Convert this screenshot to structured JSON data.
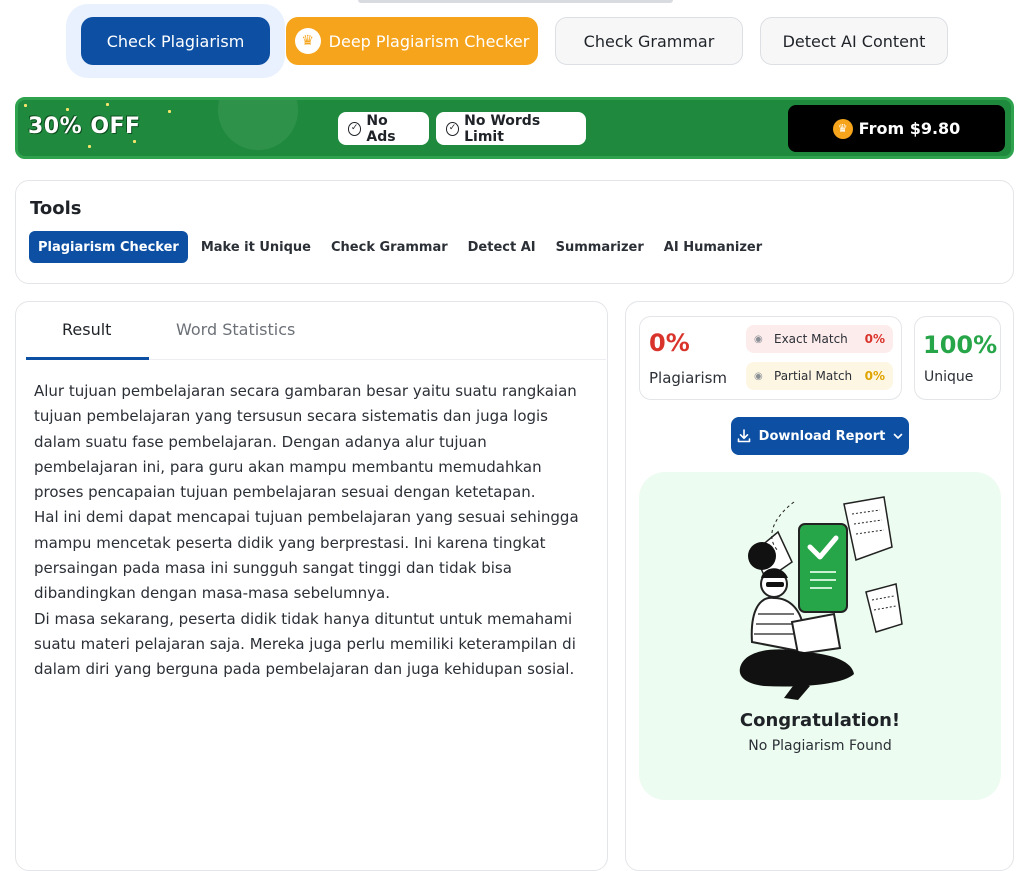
{
  "modes": {
    "check_plagiarism": "Check Plagiarism",
    "deep_checker": "Deep Plagiarism Checker",
    "check_grammar": "Check Grammar",
    "detect_ai": "Detect AI Content"
  },
  "promo": {
    "discount": "30% OFF",
    "no_ads": "No Ads",
    "no_words_limit": "No Words Limit",
    "price": "From $9.80"
  },
  "tools": {
    "title": "Tools",
    "items": [
      {
        "label": "Plagiarism Checker",
        "active": true
      },
      {
        "label": "Make it Unique"
      },
      {
        "label": "Check Grammar"
      },
      {
        "label": "Detect AI"
      },
      {
        "label": "Summarizer"
      },
      {
        "label": "AI Humanizer"
      }
    ]
  },
  "result": {
    "tabs": [
      "Result",
      "Word Statistics"
    ],
    "paragraphs": [
      "Alur tujuan pembelajaran secara gambaran besar yaitu suatu rangkaian tujuan pembelajaran yang tersusun secara sistematis dan juga logis dalam suatu fase pembelajaran. Dengan adanya alur tujuan pembelajaran ini, para guru akan mampu membantu memudahkan proses pencapaian tujuan pembelajaran sesuai dengan ketetapan.",
      "Hal ini demi dapat mencapai tujuan pembelajaran yang sesuai sehingga mampu mencetak peserta didik yang berprestasi. Ini karena tingkat persaingan pada masa ini sungguh sangat tinggi dan tidak bisa dibandingkan dengan masa-masa sebelumnya.",
      "Di masa sekarang, peserta didik tidak hanya dituntut untuk memahami suatu materi pelajaran saja. Mereka juga perlu memiliki keterampilan di dalam diri yang berguna pada pembelajaran dan juga kehidupan sosial."
    ]
  },
  "scores": {
    "plagiarism_pct": "0%",
    "plagiarism_label": "Plagiarism",
    "exact_label": "Exact Match",
    "exact_val": "0%",
    "partial_label": "Partial Match",
    "partial_val": "0%",
    "unique_pct": "100%",
    "unique_label": "Unique"
  },
  "download_label": "Download Report",
  "congrats": {
    "title": "Congratulation!",
    "subtitle": "No Plagiarism Found"
  },
  "colors": {
    "primary": "#0c4fa3",
    "deep": "#f6a41b",
    "promo_green": "#1f8a3e",
    "plag_red": "#d9342b",
    "unique_green": "#27a549"
  }
}
